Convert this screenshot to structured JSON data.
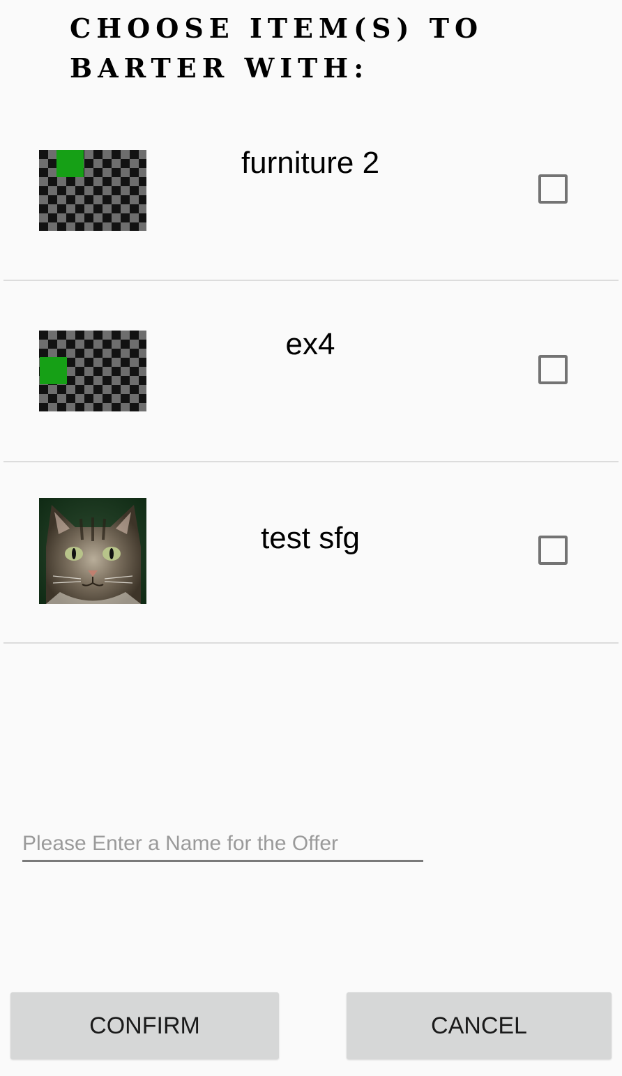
{
  "title": "Choose Item(s) to Barter With:",
  "items": [
    {
      "name": "furniture 2",
      "thumbnail": "placeholder-image",
      "checked": false
    },
    {
      "name": "ex4",
      "thumbnail": "placeholder-image",
      "checked": false
    },
    {
      "name": "test sfg",
      "thumbnail": "cat-photo",
      "checked": false
    }
  ],
  "offer": {
    "value": "",
    "placeholder": "Please Enter a Name for the Offer"
  },
  "buttons": {
    "confirm": "CONFIRM",
    "cancel": "CANCEL"
  },
  "colors": {
    "background": "#fafafa",
    "button_bg": "#d6d7d7",
    "placeholder_green": "#16a016",
    "divider": "#dcdcdc"
  }
}
